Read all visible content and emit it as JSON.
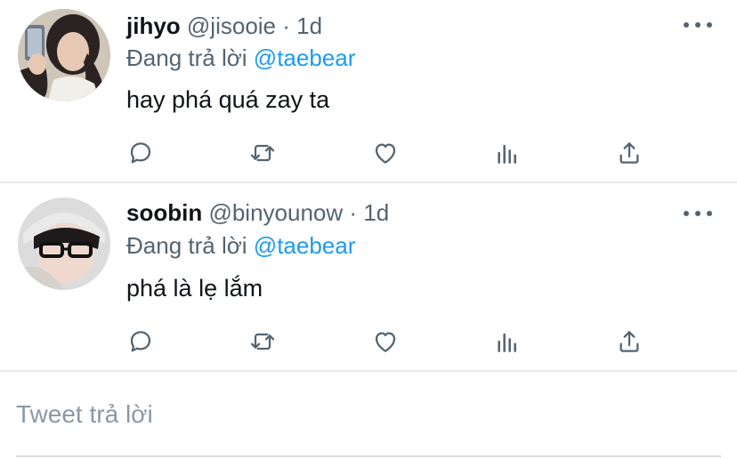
{
  "tweets": [
    {
      "name": "jihyo",
      "handle": "@jisooie",
      "separator": "·",
      "time": "1d",
      "replying_prefix": "Đang trả lời",
      "replying_to": "@taebear",
      "text": "hay phá quá zay ta"
    },
    {
      "name": "soobin",
      "handle": "@binyounow",
      "separator": "·",
      "time": "1d",
      "replying_prefix": "Đang trả lời",
      "replying_to": "@taebear",
      "text": "phá là lẹ lắm"
    }
  ],
  "actions": [
    "reply-icon",
    "retweet-icon",
    "like-icon",
    "views-icon",
    "share-icon"
  ],
  "composer": {
    "placeholder": "Tweet trả lời"
  },
  "colors": {
    "text": "#0f1419",
    "secondary": "#536471",
    "mention": "#1d9bf0",
    "divider": "#e6e8eb"
  }
}
